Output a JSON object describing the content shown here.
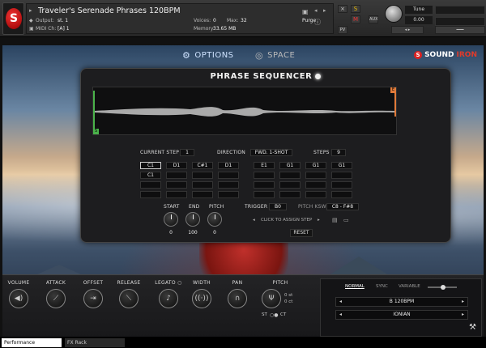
{
  "header": {
    "instrument_title": "Traveler's Serenade Phrases 120BPM",
    "output_label": "Output:",
    "output_value": "st. 1",
    "midi_label": "MIDI Ch:",
    "midi_value": "[A] 1",
    "voices_label": "Voices:",
    "voices_value": "0",
    "max_label": "Max:",
    "max_value": "32",
    "memory_label": "Memory:",
    "memory_value": "33.65 MB",
    "purge_label": "Purge",
    "tune_label": "Tune",
    "tune_value": "0.00",
    "solo_label": "S",
    "mute_label": "M",
    "aux_label": "AUX",
    "pv_label": "PV"
  },
  "nav": {
    "options_label": "OPTIONS",
    "space_label": "SPACE",
    "brand_part1": "SOUND",
    "brand_part2": "IRON"
  },
  "sequencer": {
    "title": "PHRASE SEQUENCER",
    "current_step_label": "CURRENT STEP",
    "current_step_value": "1",
    "direction_label": "DIRECTION",
    "direction_value": "FWD. 1-SHOT",
    "steps_label": "STEPS",
    "steps_value": "9",
    "grid_rows": [
      [
        "C1",
        "D1",
        "C#1",
        "D1",
        "E1",
        "G1",
        "G1",
        "G1"
      ],
      [
        "C1",
        "",
        "",
        "",
        "",
        "",
        "",
        ""
      ],
      [
        "",
        "",
        "",
        "",
        "",
        "",
        "",
        ""
      ],
      [
        "",
        "",
        "",
        "",
        "",
        "",
        "",
        ""
      ]
    ],
    "start_label": "START",
    "start_value": "0",
    "end_label": "END",
    "end_value": "100",
    "pitch_label": "PITCH",
    "pitch_value": "0",
    "trigger_label": "TRIGGER",
    "trigger_value": "B0",
    "pitch_ksw_label": "PITCH KSW",
    "pitch_ksw_value": "C8 - F#8",
    "assign_text": "CLICK TO ASSIGN STEP",
    "reset_label": "RESET",
    "wave_start_flag": "S",
    "wave_end_flag": "E"
  },
  "controls": {
    "volume_label": "VOLUME",
    "attack_label": "ATTACK",
    "offset_label": "OFFSET",
    "release_label": "RELEASE",
    "legato_label": "LEGATO",
    "width_label": "WIDTH",
    "pan_label": "PAN",
    "pitch_label": "PITCH",
    "pitch_st": "0 st",
    "pitch_ct": "0 ct",
    "st_label": "ST",
    "ct_label": "CT"
  },
  "sync_panel": {
    "normal_label": "NORMAL",
    "sync_label": "SYNC",
    "variable_label": "VARIABLE",
    "tempo_value": "B 120BPM",
    "scale_value": "IONIAN"
  },
  "bottom_tabs": {
    "performance_label": "Performance",
    "fx_rack_label": "FX Rack"
  }
}
